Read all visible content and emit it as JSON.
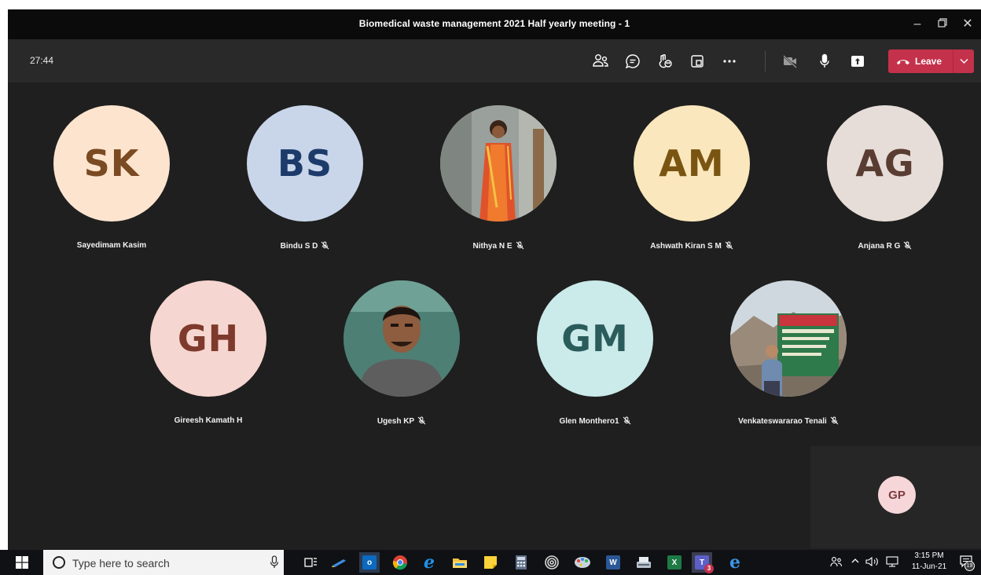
{
  "window": {
    "title": "Biomedical waste management 2021 Half yearly meeting - 1"
  },
  "toolbar": {
    "timer": "27:44",
    "icons": [
      "participants-icon",
      "chat-icon",
      "reactions-icon",
      "breakout-rooms-icon",
      "more-options-icon",
      "camera-off-icon",
      "microphone-icon",
      "share-screen-icon"
    ],
    "leave_label": "Leave"
  },
  "participants": [
    {
      "initials": "SK",
      "name": "Sayedimam Kasim",
      "muted": false,
      "bg": "#fde4cf",
      "fg": "#7a4a22"
    },
    {
      "initials": "BS",
      "name": "Bindu S D",
      "muted": true,
      "bg": "#c9d6ea",
      "fg": "#1d3b6a"
    },
    {
      "initials": "",
      "name": "Nithya N E",
      "muted": true,
      "photo": "woman-orange-saree-photo"
    },
    {
      "initials": "AM",
      "name": "Ashwath Kiran S M",
      "muted": true,
      "bg": "#fbe7bd",
      "fg": "#7a5512"
    },
    {
      "initials": "AG",
      "name": "Anjana R G",
      "muted": true,
      "bg": "#e7ddd8",
      "fg": "#5a3d32"
    },
    {
      "initials": "GH",
      "name": "Gireesh Kamath H",
      "muted": false,
      "bg": "#f6d6d0",
      "fg": "#7e3a2c"
    },
    {
      "initials": "",
      "name": "Ugesh KP",
      "muted": true,
      "photo": "man-selfie-photo"
    },
    {
      "initials": "GM",
      "name": "Glen Monthero1",
      "muted": true,
      "bg": "#cbeaea",
      "fg": "#2b5c5c"
    },
    {
      "initials": "",
      "name": "Venkateswararao Tenali",
      "muted": true,
      "photo": "man-at-khardung-la-photo"
    }
  ],
  "self": {
    "initials": "GP"
  },
  "taskbar": {
    "search_placeholder": "Type here to search",
    "apps": [
      "task-view-icon",
      "pen-app-icon",
      "outlook-icon",
      "chrome-icon",
      "internet-explorer-icon",
      "file-explorer-icon",
      "sticky-notes-icon",
      "calculator-icon",
      "spiral-app-icon",
      "paint-app-icon",
      "word-icon",
      "scanner-app-icon",
      "excel-icon",
      "teams-icon",
      "edge-icon"
    ],
    "teams_badge": "3",
    "time": "3:15 PM",
    "date": "11-Jun-21",
    "notifications": "19"
  }
}
